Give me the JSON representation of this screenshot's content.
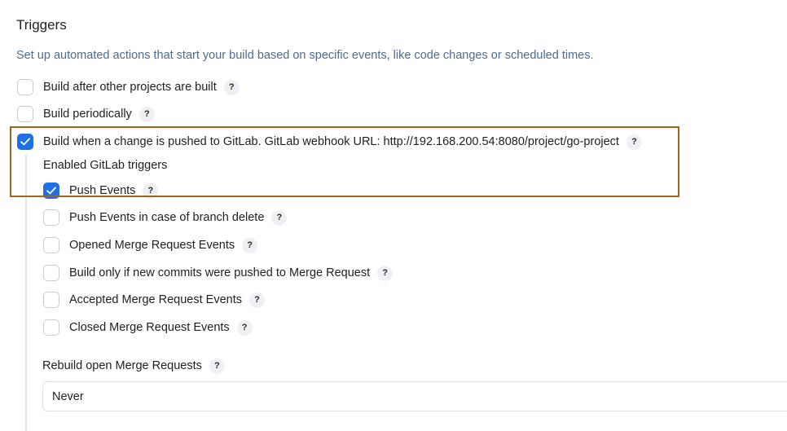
{
  "section": {
    "title": "Triggers",
    "description": "Set up automated actions that start your build based on specific events, like code changes or scheduled times."
  },
  "help_icon": {
    "label": "?"
  },
  "triggers": [
    {
      "label": "Build after other projects are built",
      "checked": false
    },
    {
      "label": "Build periodically",
      "checked": false
    },
    {
      "label": "Build when a change is pushed to GitLab. GitLab webhook URL: http://192.168.200.54:8080/project/go-project",
      "checked": true
    }
  ],
  "gitlab": {
    "enabled_label": "Enabled GitLab triggers",
    "options": [
      {
        "label": "Push Events",
        "checked": true
      },
      {
        "label": "Push Events in case of branch delete",
        "checked": false
      },
      {
        "label": "Opened Merge Request Events",
        "checked": false
      },
      {
        "label": "Build only if new commits were pushed to Merge Request",
        "checked": false
      },
      {
        "label": "Accepted Merge Request Events",
        "checked": false
      },
      {
        "label": "Closed Merge Request Events",
        "checked": false
      }
    ],
    "rebuild_label": "Rebuild open Merge Requests",
    "rebuild_value": "Never"
  },
  "colors": {
    "accent": "#1f6fe5",
    "description": "#4f6b8f",
    "highlight_border": "#a0651b"
  },
  "icons": {
    "checkbox_checked": "check-icon",
    "help": "help-icon"
  }
}
